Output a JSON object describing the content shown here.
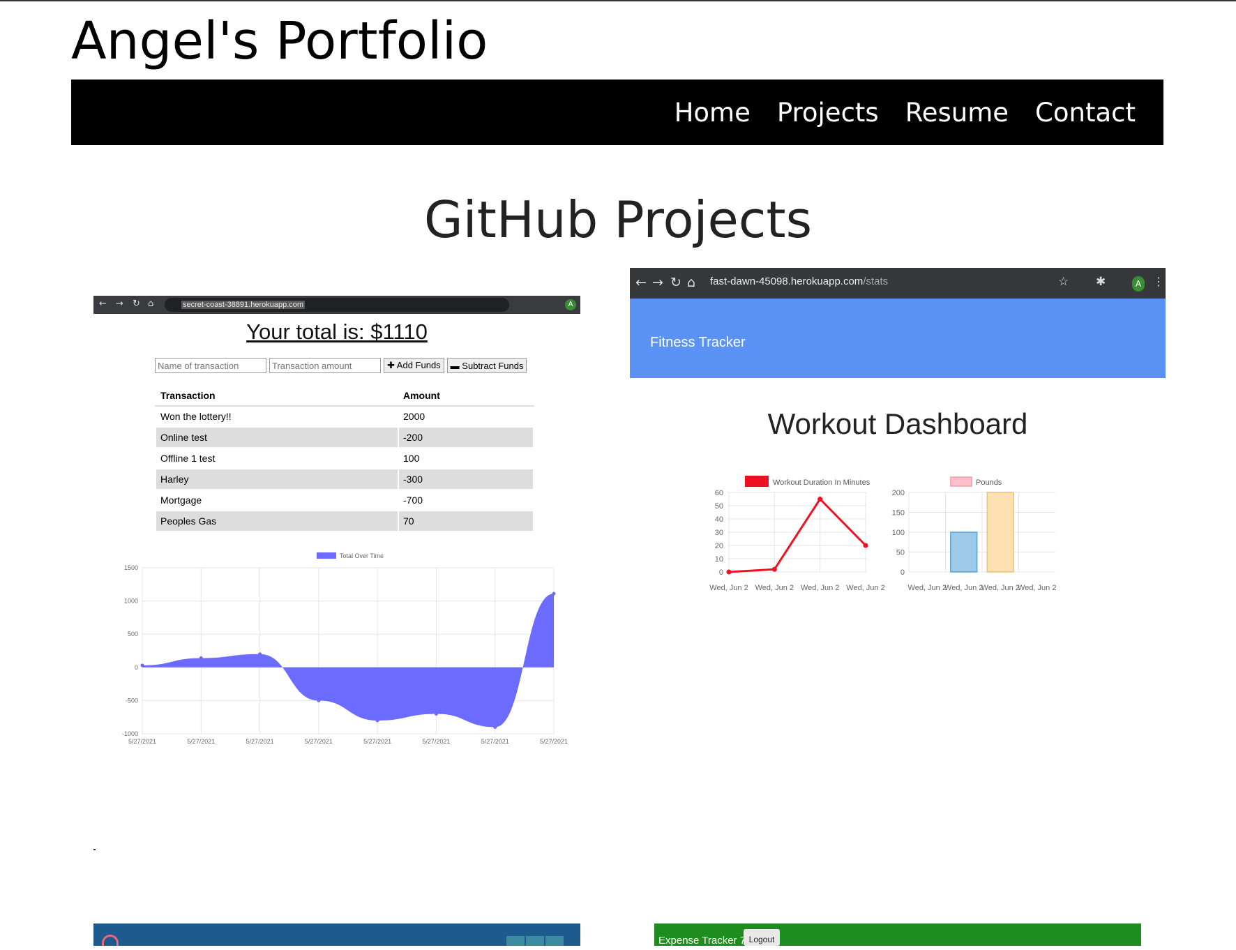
{
  "site": {
    "title": "Angel's Portfolio"
  },
  "nav": {
    "items": [
      "Home",
      "Projects",
      "Resume",
      "Contact"
    ]
  },
  "section": {
    "title": "GitHub Projects"
  },
  "budget_app": {
    "url_host": "secret-coast-38891.herokuapp.com",
    "total_text": "Your total is: $1110",
    "name_placeholder": "Name of transaction",
    "amount_placeholder": "Transaction amount",
    "add_label": "Add Funds",
    "subtract_label": "Subtract Funds",
    "avatar_letter": "A",
    "table_headers": [
      "Transaction",
      "Amount"
    ],
    "rows": [
      [
        "Won the lottery!!",
        "2000"
      ],
      [
        "Online test",
        "-200"
      ],
      [
        "Offline 1 test",
        "100"
      ],
      [
        "Harley",
        "-300"
      ],
      [
        "Mortgage",
        "-700"
      ],
      [
        "Peoples Gas",
        "70"
      ]
    ]
  },
  "fitness_app": {
    "url_host": "fast-dawn-45098.herokuapp.com",
    "url_path": "/stats",
    "avatar_letter": "A",
    "brand": "Fitness Tracker",
    "dashboard_title": "Workout Dashboard"
  },
  "expense_app": {
    "brand": "Expense Tracker 7000",
    "logout_label": "Logout"
  },
  "chart_data": [
    {
      "type": "area",
      "legend": "Total Over Time",
      "x": [
        "5/27/2021",
        "5/27/2021",
        "5/27/2021",
        "5/27/2021",
        "5/27/2021",
        "5/27/2021",
        "5/27/2021",
        "5/27/2021"
      ],
      "values": [
        30,
        140,
        200,
        -500,
        -800,
        -700,
        -900,
        1110
      ],
      "yticks": [
        1500,
        1000,
        500,
        0,
        -500,
        -1000
      ],
      "ylim": [
        -1000,
        1500
      ],
      "color": "#6b6bff"
    },
    {
      "type": "line",
      "legend": "Workout Duration In Minutes",
      "x": [
        "Wed, Jun 2",
        "Wed, Jun 2",
        "Wed, Jun 2",
        "Wed, Jun 2"
      ],
      "values": [
        0,
        2,
        55,
        20
      ],
      "yticks": [
        60,
        50,
        40,
        30,
        20,
        10,
        0
      ],
      "ylim": [
        0,
        60
      ],
      "color": "#ee1122"
    },
    {
      "type": "bar",
      "legend": "Pounds",
      "x": [
        "Wed, Jun 2",
        "Wed, Jun 2",
        "Wed, Jun 2",
        "Wed, Jun 2"
      ],
      "values": [
        0,
        100,
        200,
        0
      ],
      "yticks": [
        200,
        150,
        100,
        50,
        0
      ],
      "ylim": [
        0,
        200
      ],
      "colors": [
        "#ffc0cb",
        "#9ecae9",
        "#ffe0b0",
        "#cccccc"
      ]
    }
  ]
}
